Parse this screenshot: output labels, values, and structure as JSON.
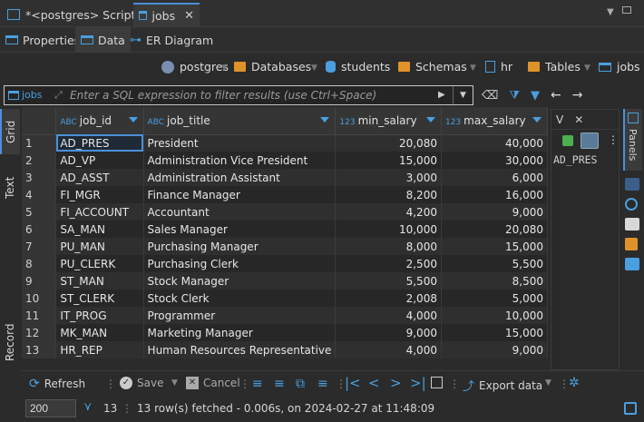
{
  "tabs": [
    {
      "label": "*<postgres> Script",
      "active": false
    },
    {
      "label": "jobs",
      "active": true
    }
  ],
  "subtabs": {
    "properties": "Properties",
    "data": "Data",
    "er": "ER Diagram"
  },
  "breadcrumb": {
    "connection": "postgres",
    "databases": "Databases",
    "db": "students",
    "schemas": "Schemas",
    "schema": "hr",
    "tables": "Tables",
    "table": "jobs"
  },
  "filter": {
    "label": "jobs",
    "placeholder": "Enter a SQL expression to filter results (use Ctrl+Space)"
  },
  "left_tabs": {
    "grid": "Grid",
    "text": "Text",
    "record": "Record"
  },
  "columns": [
    {
      "name": "job_id",
      "type": "ABC"
    },
    {
      "name": "job_title",
      "type": "ABC"
    },
    {
      "name": "min_salary",
      "type": "123"
    },
    {
      "name": "max_salary",
      "type": "123"
    }
  ],
  "rows": [
    [
      "1",
      "AD_PRES",
      "President",
      "20,080",
      "40,000"
    ],
    [
      "2",
      "AD_VP",
      "Administration Vice President",
      "15,000",
      "30,000"
    ],
    [
      "3",
      "AD_ASST",
      "Administration Assistant",
      "3,000",
      "6,000"
    ],
    [
      "4",
      "FI_MGR",
      "Finance Manager",
      "8,200",
      "16,000"
    ],
    [
      "5",
      "FI_ACCOUNT",
      "Accountant",
      "4,200",
      "9,000"
    ],
    [
      "6",
      "SA_MAN",
      "Sales Manager",
      "10,000",
      "20,080"
    ],
    [
      "7",
      "PU_MAN",
      "Purchasing Manager",
      "8,000",
      "15,000"
    ],
    [
      "8",
      "PU_CLERK",
      "Purchasing Clerk",
      "2,500",
      "5,500"
    ],
    [
      "9",
      "ST_MAN",
      "Stock Manager",
      "5,500",
      "8,500"
    ],
    [
      "10",
      "ST_CLERK",
      "Stock Clerk",
      "2,008",
      "5,000"
    ],
    [
      "11",
      "IT_PROG",
      "Programmer",
      "4,000",
      "10,000"
    ],
    [
      "12",
      "MK_MAN",
      "Marketing Manager",
      "9,000",
      "15,000"
    ],
    [
      "13",
      "HR_REP",
      "Human Resources Representative",
      "4,000",
      "9,000"
    ]
  ],
  "value_panel": {
    "tab": "V",
    "value": "AD_PRES"
  },
  "right_bar": {
    "panels": "Panels"
  },
  "bottom": {
    "refresh": "Refresh",
    "save": "Save",
    "cancel": "Cancel",
    "export": "Export data"
  },
  "status": {
    "limit": "200",
    "count": "13",
    "message": "13 row(s) fetched - 0.006s, on 2024-02-27 at 11:48:09"
  }
}
